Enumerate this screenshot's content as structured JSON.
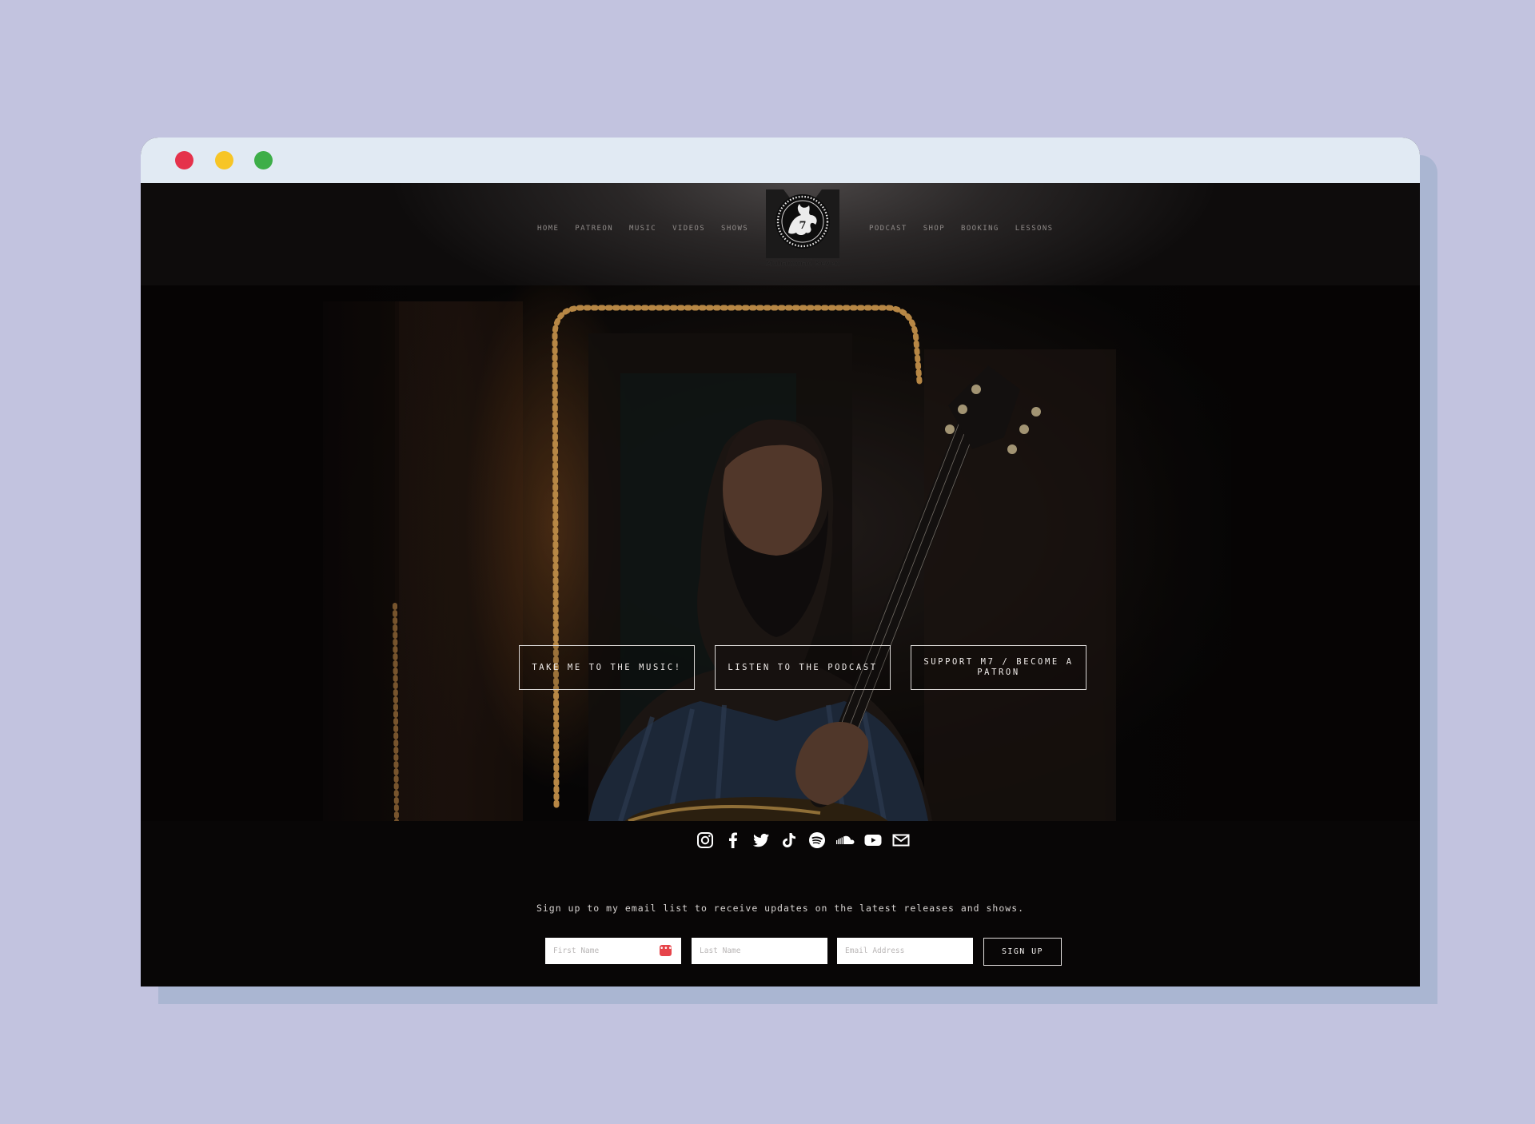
{
  "window": {
    "controls": [
      "close",
      "minimize",
      "maximize"
    ]
  },
  "nav": {
    "left": [
      "HOME",
      "PATREON",
      "MUSIC",
      "VIDEOS",
      "SHOWS"
    ],
    "right": [
      "PODCAST",
      "SHOP",
      "BOOKING",
      "LESSONS"
    ]
  },
  "logo": {
    "caption": "Muhammad Seven"
  },
  "hero": {
    "cta_music": "TAKE ME TO THE MUSIC!",
    "cta_podcast": "LISTEN TO THE PODCAST",
    "cta_patron": "SUPPORT M7 / BECOME A PATRON"
  },
  "social_icons": [
    "instagram-icon",
    "facebook-icon",
    "twitter-icon",
    "tiktok-icon",
    "spotify-icon",
    "soundcloud-icon",
    "youtube-icon",
    "email-icon"
  ],
  "signup": {
    "text": "Sign up to my email list to receive updates on the latest releases and shows.",
    "first_name_placeholder": "First Name",
    "last_name_placeholder": "Last Name",
    "email_placeholder": "Email Address",
    "button": "SIGN UP"
  },
  "colors": {
    "page_background": "#c2c3df",
    "titlebar": "#e1eaf3",
    "site_background": "#080606",
    "close": "#e5324b",
    "minimize": "#f7c526",
    "maximize": "#3dae48"
  }
}
